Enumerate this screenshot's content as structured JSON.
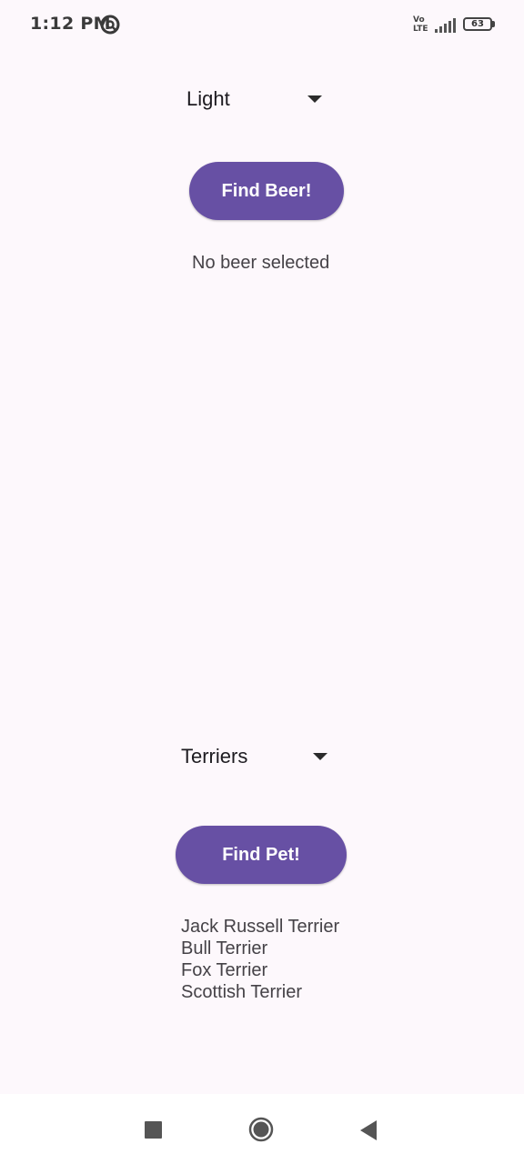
{
  "status_bar": {
    "time": "1:12 PM",
    "network_label_top": "Vo",
    "network_label_bottom": "LTE",
    "battery_level": "63"
  },
  "beer_section": {
    "selected_color": "Light",
    "button_label": "Find Beer!",
    "result_text": "No beer selected"
  },
  "pet_section": {
    "selected_type": "Terriers",
    "button_label": "Find Pet!",
    "results": [
      "Jack Russell Terrier",
      "Bull Terrier",
      "Fox Terrier",
      "Scottish Terrier"
    ]
  },
  "icons": {
    "status_app": "at-sign-icon",
    "signal": "signal-icon",
    "battery": "battery-icon",
    "nav_recents": "square-icon",
    "nav_home": "circle-icon",
    "nav_back": "triangle-back-icon"
  },
  "colors": {
    "accent": "#6750a4",
    "background": "#fdf8fc"
  }
}
